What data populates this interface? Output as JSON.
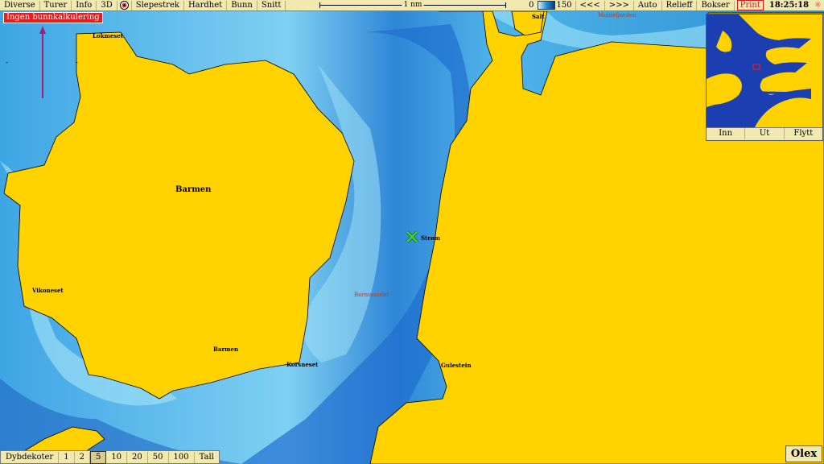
{
  "toolbar": {
    "menus": [
      "Diverse",
      "Turer",
      "Info",
      "3D",
      "Slepestrek",
      "Hardhet",
      "Bunn",
      "Snitt"
    ],
    "scale_label": "1 nm",
    "depth_min": "0",
    "depth_max": "150",
    "right_buttons": [
      "<<<",
      ">>>",
      "Auto",
      "Relieff",
      "Bokser"
    ],
    "print_label": "Print",
    "time": "18:25:18"
  },
  "warning": "Ingen bunnkalkulering",
  "minimap": {
    "buttons": [
      "Inn",
      "Ut",
      "Flytt"
    ]
  },
  "places": {
    "lokmeset": "Lokmeset",
    "barmen_big": "Barmen",
    "vikoneset": "Vikoneset",
    "barmen_small": "Barmen",
    "korsneset": "Korsneset",
    "strom": "Strøm",
    "barmsundet": "Barmsundet",
    "gulestein": "Gulestein",
    "salt": "Salt",
    "moldefjorden": "Moldefjorden"
  },
  "bottom": {
    "label": "Dybdekoter",
    "options": [
      "1",
      "2",
      "5",
      "10",
      "20",
      "50",
      "100",
      "Tall"
    ],
    "selected": "5"
  },
  "brand": "Olex",
  "colors": {
    "land": "#ffd200",
    "deep_water": "#1a64c8",
    "mid_water": "#3aa0e0",
    "shallow_water": "#9fe4f7",
    "marker": "#40d040",
    "warning_bg": "#e02020"
  }
}
